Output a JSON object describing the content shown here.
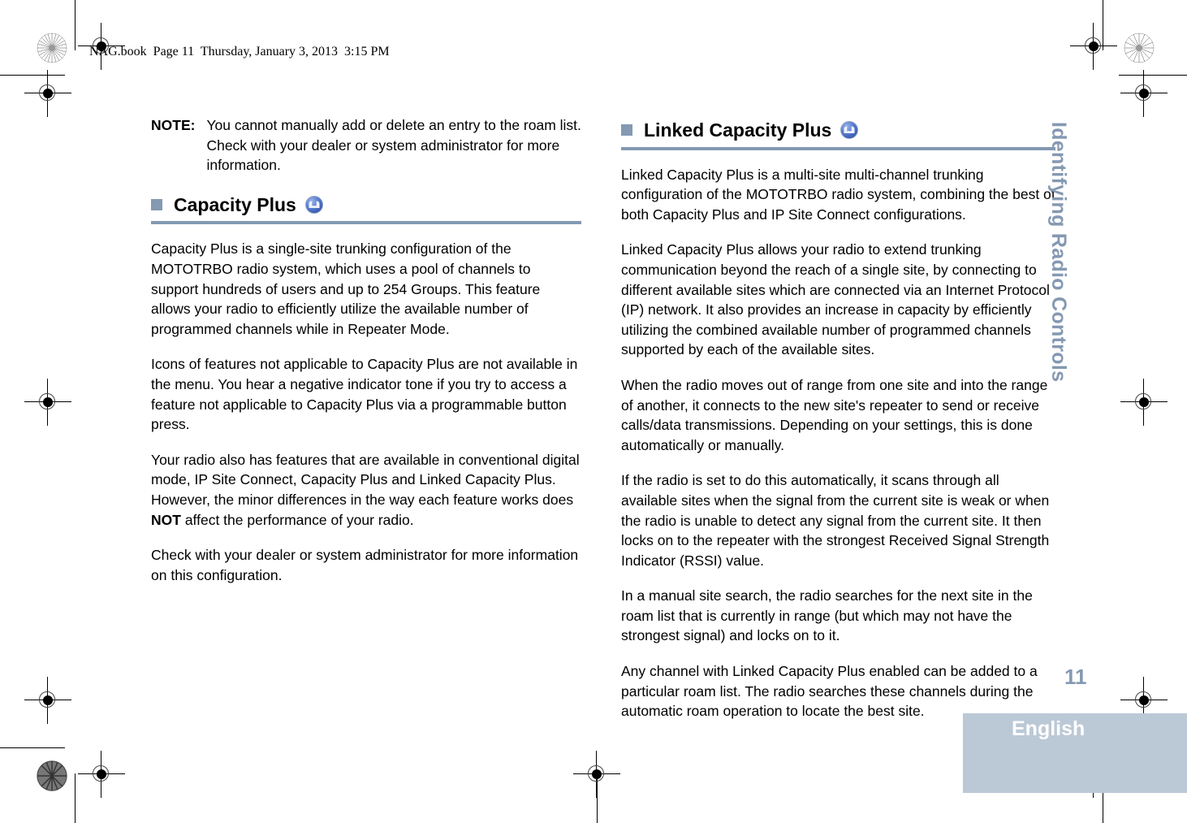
{
  "document": {
    "file_header": "NAG.book  Page 11  Thursday, January 3, 2013  3:15 PM",
    "page_number": "11",
    "language": "English",
    "chapter_title": "Identifying Radio Controls",
    "accent_color": "#8499b2",
    "footer_box_color": "#bbc8d6"
  },
  "left_column": {
    "note": {
      "label": "NOTE:",
      "text": "You cannot manually add or delete an entry to the roam list. Check with your dealer or system administrator for more information."
    },
    "section": {
      "title": "Capacity Plus",
      "icon": "capacity-plus-icon",
      "paragraphs": [
        "Capacity Plus is a single-site trunking configuration of the MOTOTRBO radio system, which uses a pool of channels to support hundreds of users and up to 254 Groups. This feature allows your radio to efficiently utilize the available number of programmed channels while in Repeater Mode.",
        "Icons of features not applicable to Capacity Plus are not available in the menu. You hear a negative indicator tone if you try to access a feature not applicable to Capacity Plus via a programmable button press.",
        "Check with your dealer or system administrator for more information on this configuration."
      ],
      "paragraph_with_bold": {
        "before": "Your radio also has features that are available in conventional digital mode, IP Site Connect, Capacity Plus and Linked Capacity Plus. However, the minor differences in the way each feature works does ",
        "bold": "NOT",
        "after": " affect the performance of your radio."
      }
    }
  },
  "right_column": {
    "section": {
      "title": "Linked Capacity Plus",
      "icon": "capacity-plus-icon",
      "paragraphs": [
        "Linked Capacity Plus is a multi-site multi-channel trunking configuration of the MOTOTRBO radio system, combining the best of both Capacity Plus and IP Site Connect configurations.",
        "Linked Capacity Plus allows your radio to extend trunking communication beyond the reach of a single site, by connecting to different available sites which are connected via an Internet Protocol (IP) network. It also provides an increase in capacity by efficiently utilizing the combined available number of programmed channels supported by each of the available sites.",
        "When the radio moves out of range from one site and into the range of another, it connects to the new site's repeater to send or receive calls/data transmissions. Depending on your settings, this is done automatically or manually.",
        "If the radio is set to do this automatically, it scans through all available sites when the signal from the current site is weak or when the radio is unable to detect any signal from the current site. It then locks on to the repeater with the strongest Received Signal Strength Indicator (RSSI) value.",
        "In a manual site search, the radio searches for the next site in the roam list that is currently in range (but which may not have the strongest signal) and locks on to it.",
        "Any channel with Linked Capacity Plus enabled can be added to a particular roam list. The radio searches these channels during the automatic roam operation to locate the best site."
      ]
    }
  }
}
